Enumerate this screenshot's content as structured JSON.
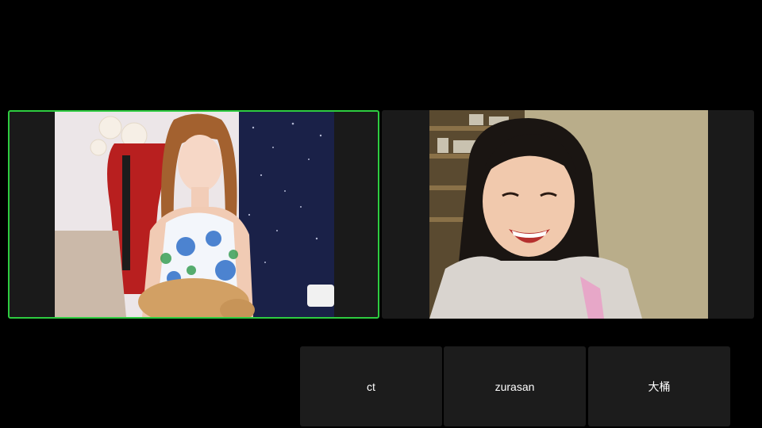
{
  "participants": {
    "thumbnails": [
      {
        "name": "ct"
      },
      {
        "name": "zurasan"
      },
      {
        "name": "大桶"
      }
    ]
  },
  "colors": {
    "active_speaker_border": "#2ecc40",
    "tile_background": "#1a1a1a",
    "thumbnail_background": "#1c1c1c",
    "page_background": "#000000"
  }
}
